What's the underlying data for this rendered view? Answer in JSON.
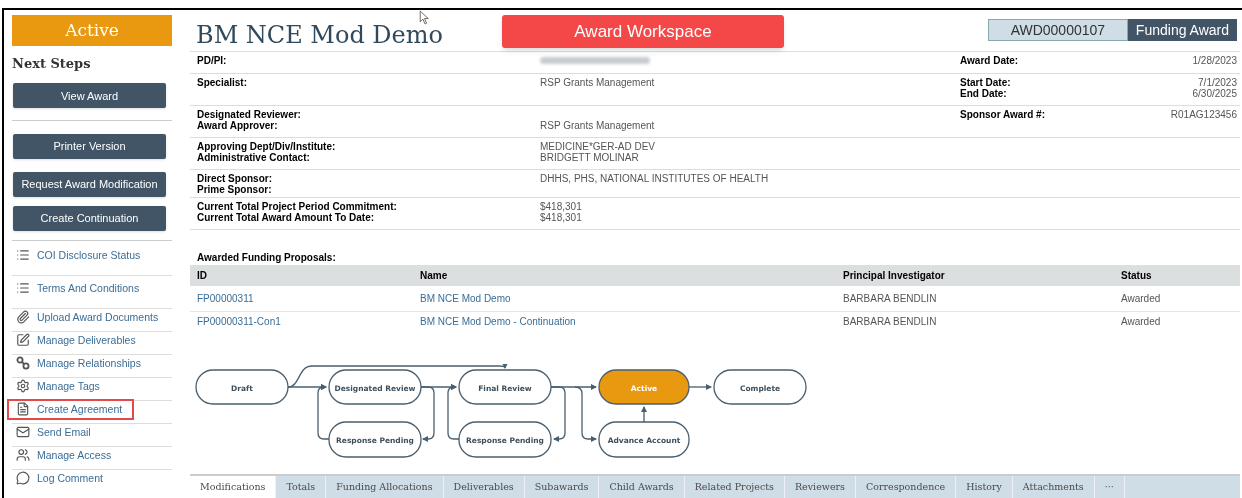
{
  "sidebar": {
    "status": "Active",
    "heading": "Next Steps",
    "buttons": [
      "View Award",
      "Printer Version",
      "Request Award Modification",
      "Create Continuation"
    ],
    "links": [
      {
        "label": "COI Disclosure Status",
        "kind": "list",
        "highlighted": false
      },
      {
        "label": "Terms And Conditions",
        "kind": "list",
        "highlighted": false
      },
      {
        "label": "Upload Award Documents",
        "kind": "paperclip",
        "highlighted": false
      },
      {
        "label": "Manage Deliverables",
        "kind": "edit",
        "highlighted": false
      },
      {
        "label": "Manage Relationships",
        "kind": "relationships",
        "highlighted": false
      },
      {
        "label": "Manage Tags",
        "kind": "gear",
        "highlighted": false
      },
      {
        "label": "Create Agreement",
        "kind": "document",
        "highlighted": true
      },
      {
        "label": "Send Email",
        "kind": "mail",
        "highlighted": false
      },
      {
        "label": "Manage Access",
        "kind": "people",
        "highlighted": false
      },
      {
        "label": "Log Comment",
        "kind": "comment",
        "highlighted": false
      }
    ]
  },
  "header": {
    "title": "BM NCE Mod Demo",
    "banner": "Award Workspace",
    "record_id": "AWD00000107",
    "record_type": "Funding Award"
  },
  "details": [
    {
      "fields": [
        {
          "label": "PD/PI:",
          "redacted": true
        }
      ],
      "right": [
        {
          "label": "Award Date:",
          "value": "1/28/2023"
        }
      ]
    },
    {
      "fields": [
        {
          "label": "Specialist:",
          "value": "RSP Grants Management"
        }
      ],
      "right": [
        {
          "label": "Start Date:",
          "value": "7/1/2023"
        },
        {
          "label": "End Date:",
          "value": "6/30/2025"
        }
      ]
    },
    {
      "fields": [
        {
          "label": "Designated Reviewer:",
          "redacted": false
        },
        {
          "label": "Award Approver:",
          "value": "RSP Grants Management"
        }
      ],
      "right": [
        {
          "label": "Sponsor Award #:",
          "value": "R01AG123456"
        }
      ]
    },
    {
      "fields": [
        {
          "label": "Approving Dept/Div/Institute:",
          "value": "MEDICINE*GER-AD DEV"
        },
        {
          "label": "Administrative Contact:",
          "value": "BRIDGETT MOLINAR"
        }
      ]
    },
    {
      "fields": [
        {
          "label": "Direct Sponsor:",
          "value": "DHHS, PHS, NATIONAL INSTITUTES OF HEALTH"
        },
        {
          "label": "Prime Sponsor:",
          "redacted": false
        }
      ]
    },
    {
      "fields": [
        {
          "label": "Current Total Project Period Commitment:",
          "value": "$418,301"
        },
        {
          "label": "Current Total Award Amount To Date:",
          "value": "$418,301"
        }
      ]
    }
  ],
  "funding": {
    "title": "Awarded Funding Proposals:",
    "columns": [
      "ID",
      "Name",
      "Principal Investigator",
      "Status"
    ],
    "rows": [
      [
        "FP00000311",
        "BM NCE Mod Demo",
        "BARBARA BENDLIN",
        "Awarded"
      ],
      [
        "FP00000311-Con1",
        "BM NCE Mod Demo - Continuation",
        "BARBARA BENDLIN",
        "Awarded"
      ]
    ]
  },
  "workflow": [
    {
      "label": "Draft",
      "selected": false
    },
    {
      "label": "Designated Review",
      "selected": false
    },
    {
      "label": "Final Review",
      "selected": false
    },
    {
      "label": "Active",
      "selected": true
    },
    {
      "label": "Complete",
      "selected": false
    },
    {
      "label": "Response Pending",
      "selected": false
    },
    {
      "label": "Response Pending",
      "selected": false
    },
    {
      "label": "Advance Account",
      "selected": false
    }
  ],
  "tabs": [
    {
      "label": "Modifications",
      "selected": true
    },
    {
      "label": "Totals",
      "selected": false
    },
    {
      "label": "Funding Allocations",
      "selected": false
    },
    {
      "label": "Deliverables",
      "selected": false
    },
    {
      "label": "Subawards",
      "selected": false
    },
    {
      "label": "Child Awards",
      "selected": false
    },
    {
      "label": "Related Projects",
      "selected": false
    },
    {
      "label": "Reviewers",
      "selected": false
    },
    {
      "label": "Correspondence",
      "selected": false
    },
    {
      "label": "History",
      "selected": false
    },
    {
      "label": "Attachments",
      "selected": false
    },
    {
      "label": "···",
      "selected": false
    }
  ]
}
